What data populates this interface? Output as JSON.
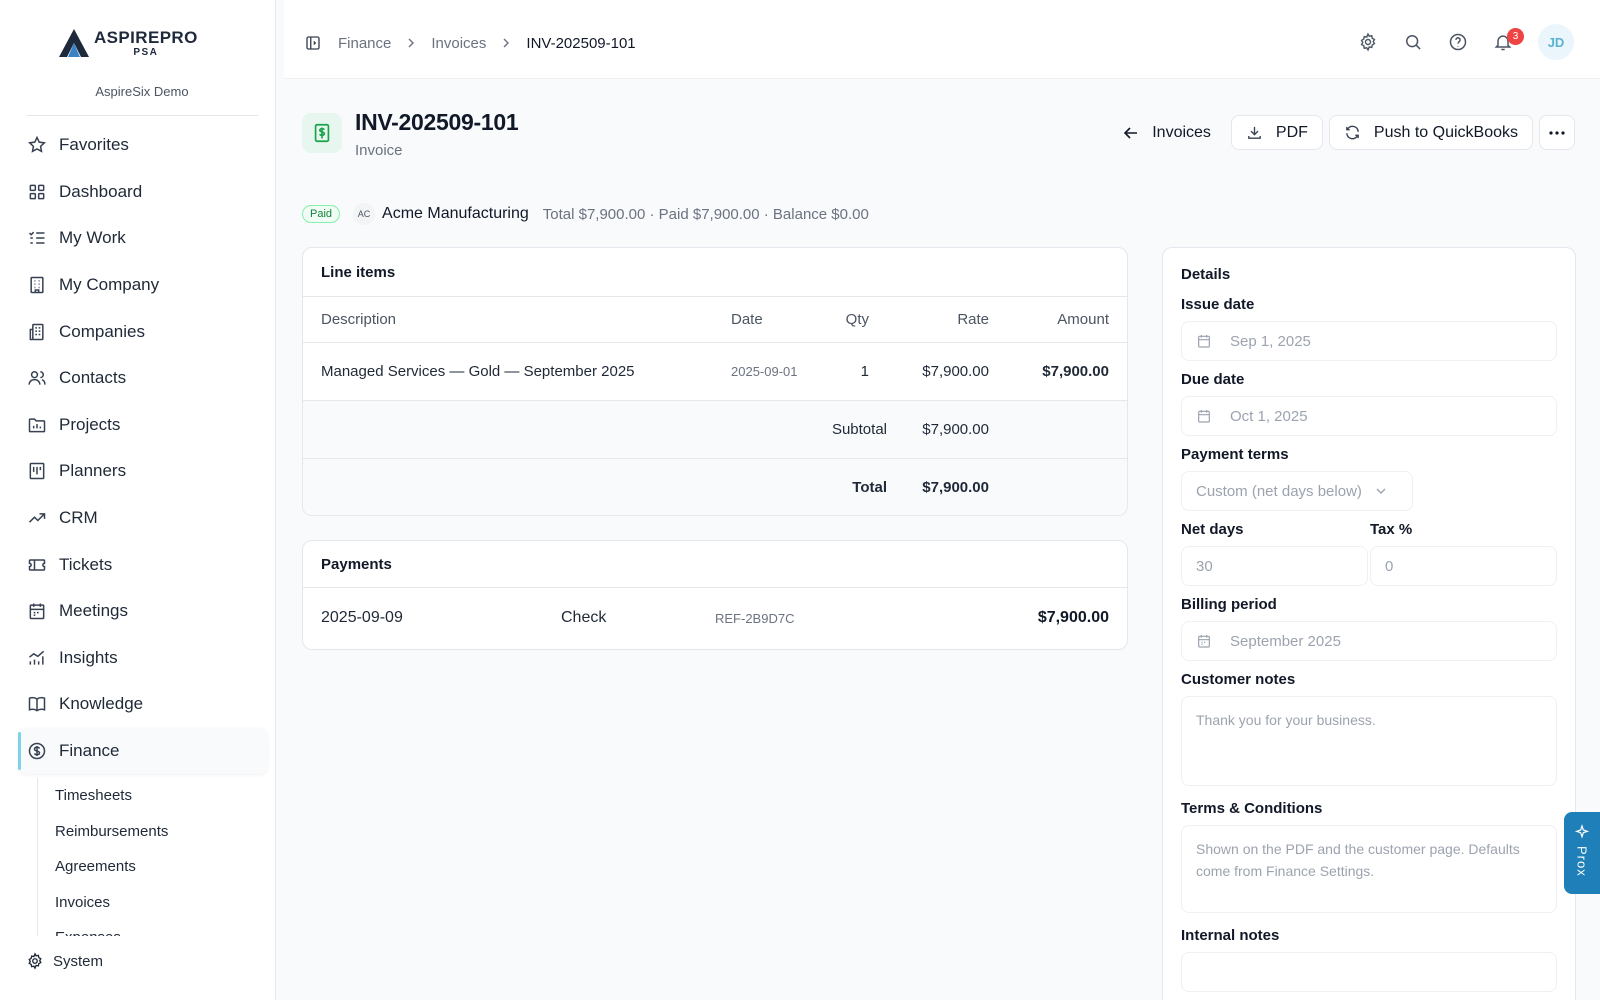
{
  "brand": {
    "name": "ASPIREPRO",
    "sub": "PSA",
    "tenant": "AspireSix Demo"
  },
  "sidebar": {
    "items": [
      {
        "label": "Favorites",
        "icon": "star-icon"
      },
      {
        "label": "Dashboard",
        "icon": "grid-icon"
      },
      {
        "label": "My Work",
        "icon": "list-check-icon"
      },
      {
        "label": "My Company",
        "icon": "building-icon"
      },
      {
        "label": "Companies",
        "icon": "buildings-icon"
      },
      {
        "label": "Contacts",
        "icon": "users-icon"
      },
      {
        "label": "Projects",
        "icon": "folder-icon"
      },
      {
        "label": "Planners",
        "icon": "kanban-icon"
      },
      {
        "label": "CRM",
        "icon": "trending-up-icon"
      },
      {
        "label": "Tickets",
        "icon": "ticket-icon"
      },
      {
        "label": "Meetings",
        "icon": "calendar-icon"
      },
      {
        "label": "Insights",
        "icon": "chart-icon"
      },
      {
        "label": "Knowledge",
        "icon": "book-icon"
      },
      {
        "label": "Finance",
        "icon": "dollar-circle-icon",
        "active": true
      }
    ],
    "finance_sub": [
      "Timesheets",
      "Reimbursements",
      "Agreements",
      "Invoices",
      "Expenses"
    ],
    "system": "System"
  },
  "topbar": {
    "breadcrumb": [
      "Finance",
      "Invoices",
      "INV-202509-101"
    ],
    "notifications_count": "3",
    "avatar_initials": "JD"
  },
  "page": {
    "title": "INV-202509-101",
    "subtitle": "Invoice",
    "back_label": "Invoices",
    "pdf_label": "PDF",
    "push_label": "Push to QuickBooks"
  },
  "meta": {
    "status": "Paid",
    "company_initials": "AC",
    "company": "Acme Manufacturing",
    "totals": "Total $7,900.00 · Paid $7,900.00 · Balance $0.00"
  },
  "line_items": {
    "title": "Line items",
    "columns": [
      "Description",
      "Date",
      "Qty",
      "Rate",
      "Amount"
    ],
    "rows": [
      {
        "description": "Managed Services — Gold — September 2025",
        "date": "2025-09-01",
        "qty": "1",
        "rate": "$7,900.00",
        "amount": "$7,900.00"
      }
    ],
    "subtotal_label": "Subtotal",
    "subtotal_value": "$7,900.00",
    "total_label": "Total",
    "total_value": "$7,900.00"
  },
  "payments": {
    "title": "Payments",
    "rows": [
      {
        "date": "2025-09-09",
        "method": "Check",
        "ref": "REF-2B9D7C",
        "amount": "$7,900.00"
      }
    ]
  },
  "details": {
    "title": "Details",
    "issue_date_label": "Issue date",
    "issue_date": "Sep 1, 2025",
    "due_date_label": "Due date",
    "due_date": "Oct 1, 2025",
    "payment_terms_label": "Payment terms",
    "payment_terms": "Custom (net days below)",
    "net_days_label": "Net days",
    "net_days": "30",
    "tax_label": "Tax %",
    "tax": "0",
    "billing_period_label": "Billing period",
    "billing_period": "September 2025",
    "customer_notes_label": "Customer notes",
    "customer_notes_placeholder": "Thank you for your business.",
    "terms_label": "Terms & Conditions",
    "terms_placeholder": "Shown on the PDF and the customer page. Defaults come from Finance Settings.",
    "internal_notes_label": "Internal notes"
  },
  "assistant": {
    "label": "Prox"
  },
  "colors": {
    "accent": "#1f7fb8",
    "paid_green": "#15803d",
    "badge_red": "#ef4444"
  }
}
